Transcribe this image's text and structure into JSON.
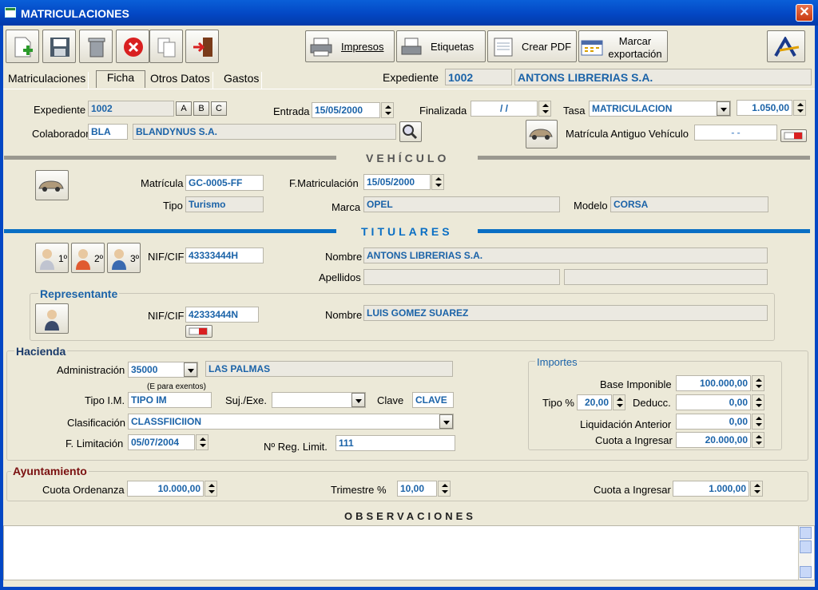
{
  "window": {
    "title": "MATRICULACIONES",
    "close": "✕"
  },
  "toolbar": {
    "impresos": "Impresos",
    "etiquetas": "Etiquetas",
    "crear_pdf": "Crear PDF",
    "marcar_1": "Marcar",
    "marcar_2": "exportación"
  },
  "tabs": [
    "Matriculaciones",
    "Ficha",
    "Otros Datos",
    "Gastos"
  ],
  "header": {
    "expediente_label": "Expediente",
    "expediente": "1002",
    "cliente": "ANTONS LIBRERIAS S.A."
  },
  "ficha": {
    "expediente_label": "Expediente",
    "expediente": "1002",
    "btn_a": "A",
    "btn_b": "B",
    "btn_c": "C",
    "entrada_label": "Entrada",
    "entrada": "15/05/2000",
    "finalizada_label": "Finalizada",
    "finalizada": "/ /",
    "tasa_label": "Tasa",
    "tasa": "MATRICULACION",
    "tasa_importe": "1.050,00",
    "colaborador_label": "Colaborador",
    "colaborador_code": "BLA",
    "colaborador_name": "BLANDYNUS S.A.",
    "matricula_antiguo_label": "Matrícula Antiguo Vehículo",
    "matricula_antiguo": "- -"
  },
  "vehiculo": {
    "title": "VEHÍCULO",
    "matricula_label": "Matrícula",
    "matricula": "GC-0005-FF",
    "fmat_label": "F.Matriculación",
    "fmat": "15/05/2000",
    "tipo_label": "Tipo",
    "tipo": "Turismo",
    "marca_label": "Marca",
    "marca": "OPEL",
    "modelo_label": "Modelo",
    "modelo": "CORSA"
  },
  "titulares": {
    "title": "TITULARES",
    "b1": "1º",
    "b2": "2º",
    "b3": "3º",
    "nif_label": "NIF/CIF",
    "nif": "43333444H",
    "nombre_label": "Nombre",
    "nombre": "ANTONS LIBRERIAS S.A.",
    "apellidos_label": "Apellidos"
  },
  "representante": {
    "title": "Representante",
    "nif_label": "NIF/CIF",
    "nif": "42333444N",
    "nombre_label": "Nombre",
    "nombre": "LUIS GOMEZ SUAREZ"
  },
  "hacienda": {
    "title": "Hacienda",
    "admin_label": "Administración",
    "admin_code": "35000",
    "admin_name": "LAS PALMAS",
    "exentos_note": "(E para exentos)",
    "tipo_im_label": "Tipo I.M.",
    "tipo_im": "TIPO IM",
    "sujexe_label": "Suj./Exe.",
    "clave_label": "Clave",
    "clave": "CLAVE",
    "clasif_label": "Clasificación",
    "clasif": "CLASSFIICIION",
    "flimit_label": "F. Limitación",
    "flimit": "05/07/2004",
    "nreg_label": "Nº Reg. Limit.",
    "nreg": "111"
  },
  "importes": {
    "title": "Importes",
    "base_label": "Base Imponible",
    "base": "100.000,00",
    "tipo_label": "Tipo %",
    "tipo": "20,00",
    "deducc_label": "Deducc.",
    "deducc": "0,00",
    "liq_label": "Liquidación Anterior",
    "liq": "0,00",
    "cuota_label": "Cuota a Ingresar",
    "cuota": "20.000,00"
  },
  "ayuntamiento": {
    "title": "Ayuntamiento",
    "cuota_ord_label": "Cuota Ordenanza",
    "cuota_ord": "10.000,00",
    "trimestre_label": "Trimestre %",
    "trimestre": "10,00",
    "cuota_label": "Cuota a Ingresar",
    "cuota": "1.000,00"
  },
  "observaciones": {
    "title": "OBSERVACIONES"
  },
  "colors": {
    "titlebar": "#0347c4",
    "section_line": "#0a6fc4",
    "value_text": "#1b63a8",
    "group_title": "#7a1010"
  }
}
